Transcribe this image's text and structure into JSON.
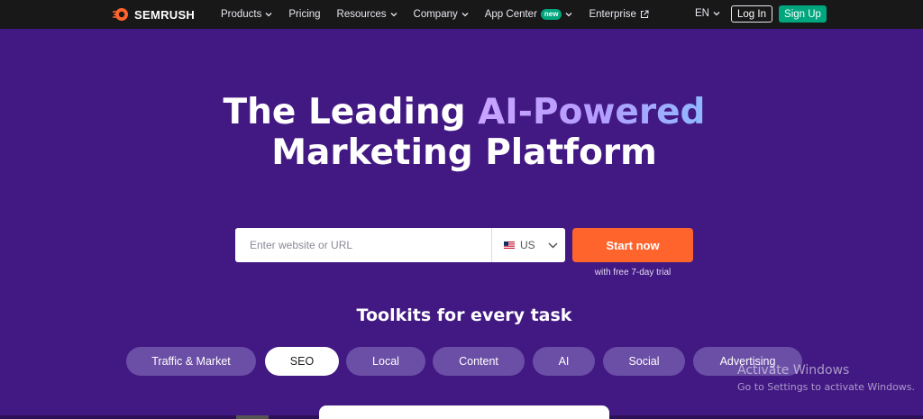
{
  "brand": {
    "name": "SEMRUSH",
    "color": "#ff642d"
  },
  "nav": {
    "items": [
      {
        "label": "Products",
        "dropdown": true
      },
      {
        "label": "Pricing",
        "dropdown": false
      },
      {
        "label": "Resources",
        "dropdown": true
      },
      {
        "label": "Company",
        "dropdown": true
      },
      {
        "label": "App Center",
        "badge": "new",
        "dropdown": true
      },
      {
        "label": "Enterprise",
        "external": true
      }
    ],
    "language": "EN",
    "login_label": "Log In",
    "signup_label": "Sign Up"
  },
  "hero": {
    "title_part1": "The Leading ",
    "title_accent": "AI-Powered",
    "title_line2": "Marketing Platform"
  },
  "search": {
    "placeholder": "Enter website or URL",
    "country": "US",
    "start_label": "Start now",
    "trial_note": "with free 7-day trial"
  },
  "toolkits": {
    "title": "Toolkits for every task",
    "items": [
      "Traffic & Market",
      "SEO",
      "Local",
      "Content",
      "AI",
      "Social",
      "Advertising"
    ],
    "active": "SEO"
  },
  "watermark": {
    "title": "Activate Windows",
    "subtitle": "Go to Settings to activate Windows."
  },
  "colors": {
    "background": "#421983",
    "topbar": "#181818",
    "cta": "#ff642d",
    "signup": "#00a67e",
    "pill": "#6b4ea6"
  }
}
